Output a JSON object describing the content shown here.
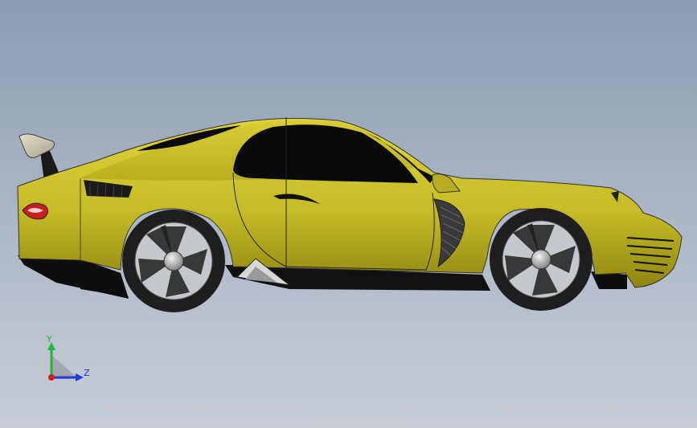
{
  "window": {
    "title": ""
  },
  "triad": {
    "y_label": "Y",
    "z_label": "Z",
    "y_color": "#1fb83a",
    "z_color": "#1f3fd6",
    "x_color": "#d42020"
  },
  "model": {
    "name": "",
    "body_color": "#c9be2a",
    "body_dark": "#9e9418",
    "glass_color": "#0a0a0a",
    "tire_color": "#2a2a2a",
    "rim_color": "#b9bcc0"
  }
}
